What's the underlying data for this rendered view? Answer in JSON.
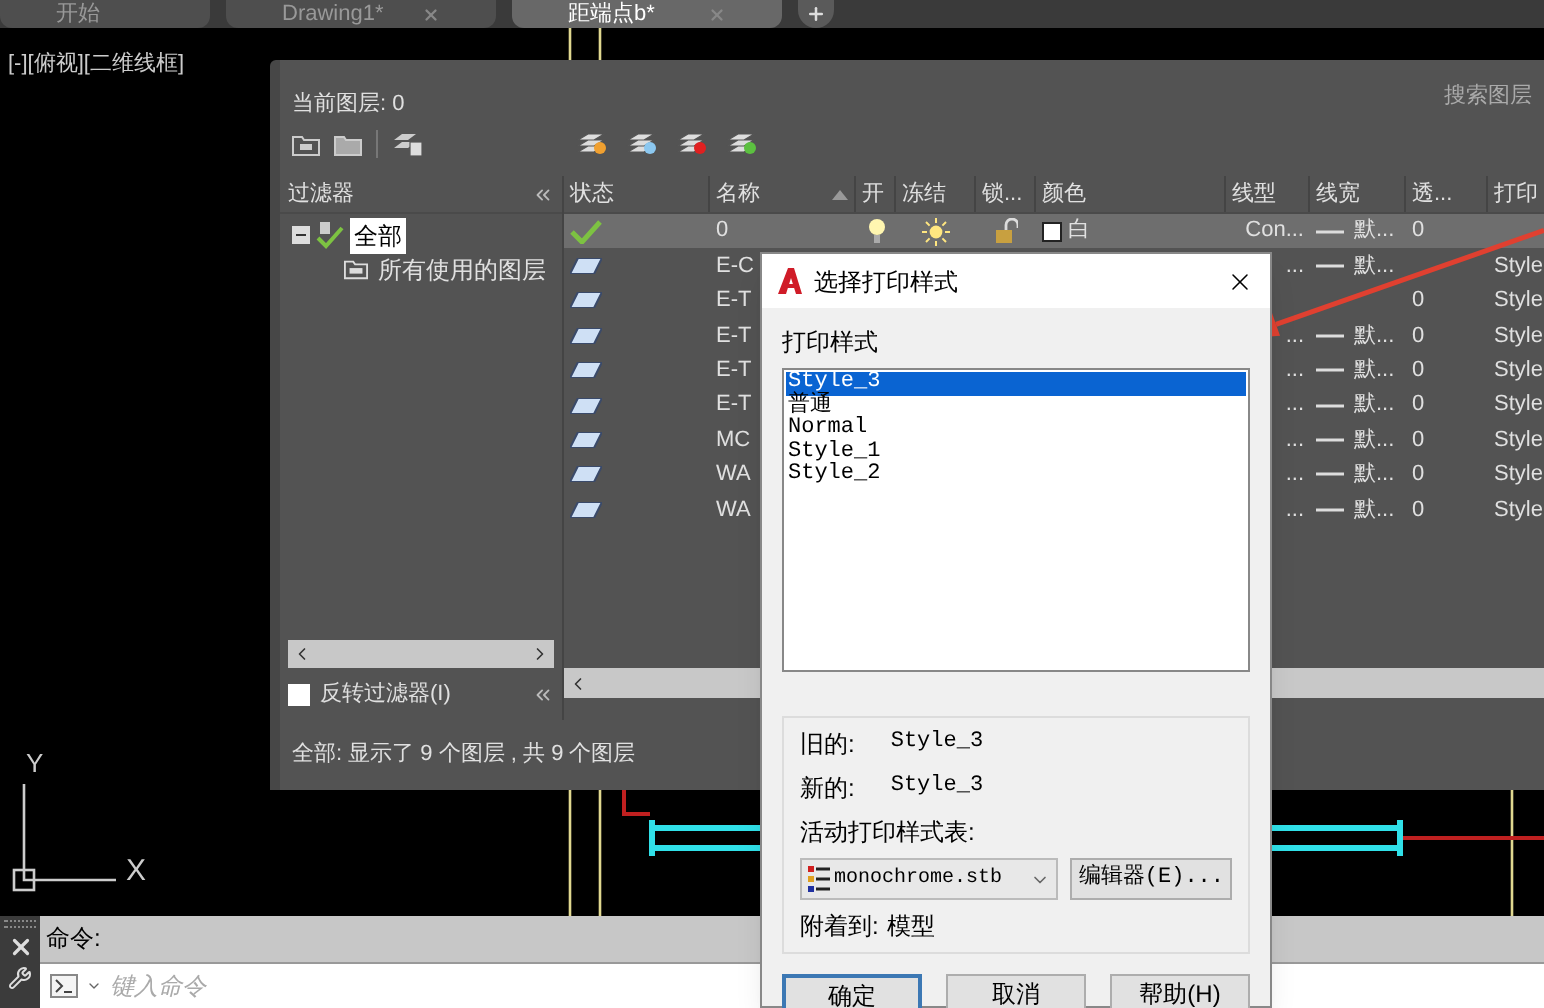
{
  "tabs": [
    {
      "label": "开始",
      "selected": false,
      "closable": false
    },
    {
      "label": "Drawing1*",
      "selected": false,
      "closable": true
    },
    {
      "label": "距端点b*",
      "selected": true,
      "closable": true
    }
  ],
  "viewport_label": "[-][俯视][二维线框]",
  "ucs": {
    "x_label": "X",
    "y_label": "Y"
  },
  "layer_palette": {
    "current_layer": "当前图层: 0",
    "search_placeholder": "搜索图层",
    "filter_title": "过滤器",
    "filter_tree": [
      {
        "label": "全部",
        "selected": true,
        "children": [
          {
            "label": "所有使用的图层",
            "selected": false
          }
        ]
      }
    ],
    "invert_filter": {
      "label": "反转过滤器(I)",
      "checked": false
    },
    "columns": [
      "状态",
      "名称",
      "开",
      "冻结",
      "锁...",
      "颜色",
      "线型",
      "线宽",
      "透...",
      "打印"
    ],
    "rows": [
      {
        "kind": "current",
        "selected": true,
        "name": "0",
        "on": true,
        "frozen": false,
        "locked": false,
        "color_name": "白",
        "linetype": "Con...",
        "lineweight": "默...",
        "transparency": "0"
      },
      {
        "kind": "layer",
        "selected": false,
        "name": "E-C",
        "linetype": "...",
        "lineweight": "默...",
        "plot_style": "Style"
      },
      {
        "kind": "layer",
        "selected": false,
        "name": "E-T",
        "transparency": "0",
        "plot_style": "Style"
      },
      {
        "kind": "layer",
        "selected": false,
        "name": "E-T",
        "linetype": "...",
        "lineweight": "默...",
        "transparency": "0",
        "plot_style": "Style"
      },
      {
        "kind": "layer",
        "selected": false,
        "name": "E-T",
        "linetype": "...",
        "lineweight": "默...",
        "transparency": "0",
        "plot_style": "Style"
      },
      {
        "kind": "layer",
        "selected": false,
        "name": "E-T",
        "linetype": "...",
        "lineweight": "默...",
        "transparency": "0",
        "plot_style": "Style"
      },
      {
        "kind": "layer",
        "selected": false,
        "name": "MC",
        "linetype": "...",
        "lineweight": "默...",
        "transparency": "0",
        "plot_style": "Style"
      },
      {
        "kind": "layer",
        "selected": false,
        "name": "WA",
        "linetype": "...",
        "lineweight": "默...",
        "transparency": "0",
        "plot_style": "Style"
      },
      {
        "kind": "layer",
        "selected": false,
        "name": "WA",
        "linetype": "...",
        "lineweight": "默...",
        "transparency": "0",
        "plot_style": "Style"
      }
    ],
    "status": "全部: 显示了 9 个图层 , 共 9 个图层"
  },
  "dialog": {
    "title": "选择打印样式",
    "list_label": "打印样式",
    "styles": [
      {
        "label": "Style_3",
        "selected": true
      },
      {
        "label": "普通",
        "selected": false
      },
      {
        "label": "Normal",
        "selected": false
      },
      {
        "label": "Style_1",
        "selected": false
      },
      {
        "label": "Style_2",
        "selected": false
      }
    ],
    "old_label": "旧的:",
    "old_value": "Style_3",
    "new_label": "新的:",
    "new_value": "Style_3",
    "table_label": "活动打印样式表:",
    "table_value": "monochrome.stb",
    "editor_button": "编辑器(E)...",
    "attached_label": "附着到:",
    "attached_value": "模型",
    "buttons": [
      {
        "label": "确定",
        "default": true
      },
      {
        "label": "取消",
        "default": false
      },
      {
        "label": "帮助(H)",
        "default": false
      }
    ]
  },
  "command": {
    "label": "命令:",
    "placeholder": "键入命令"
  }
}
